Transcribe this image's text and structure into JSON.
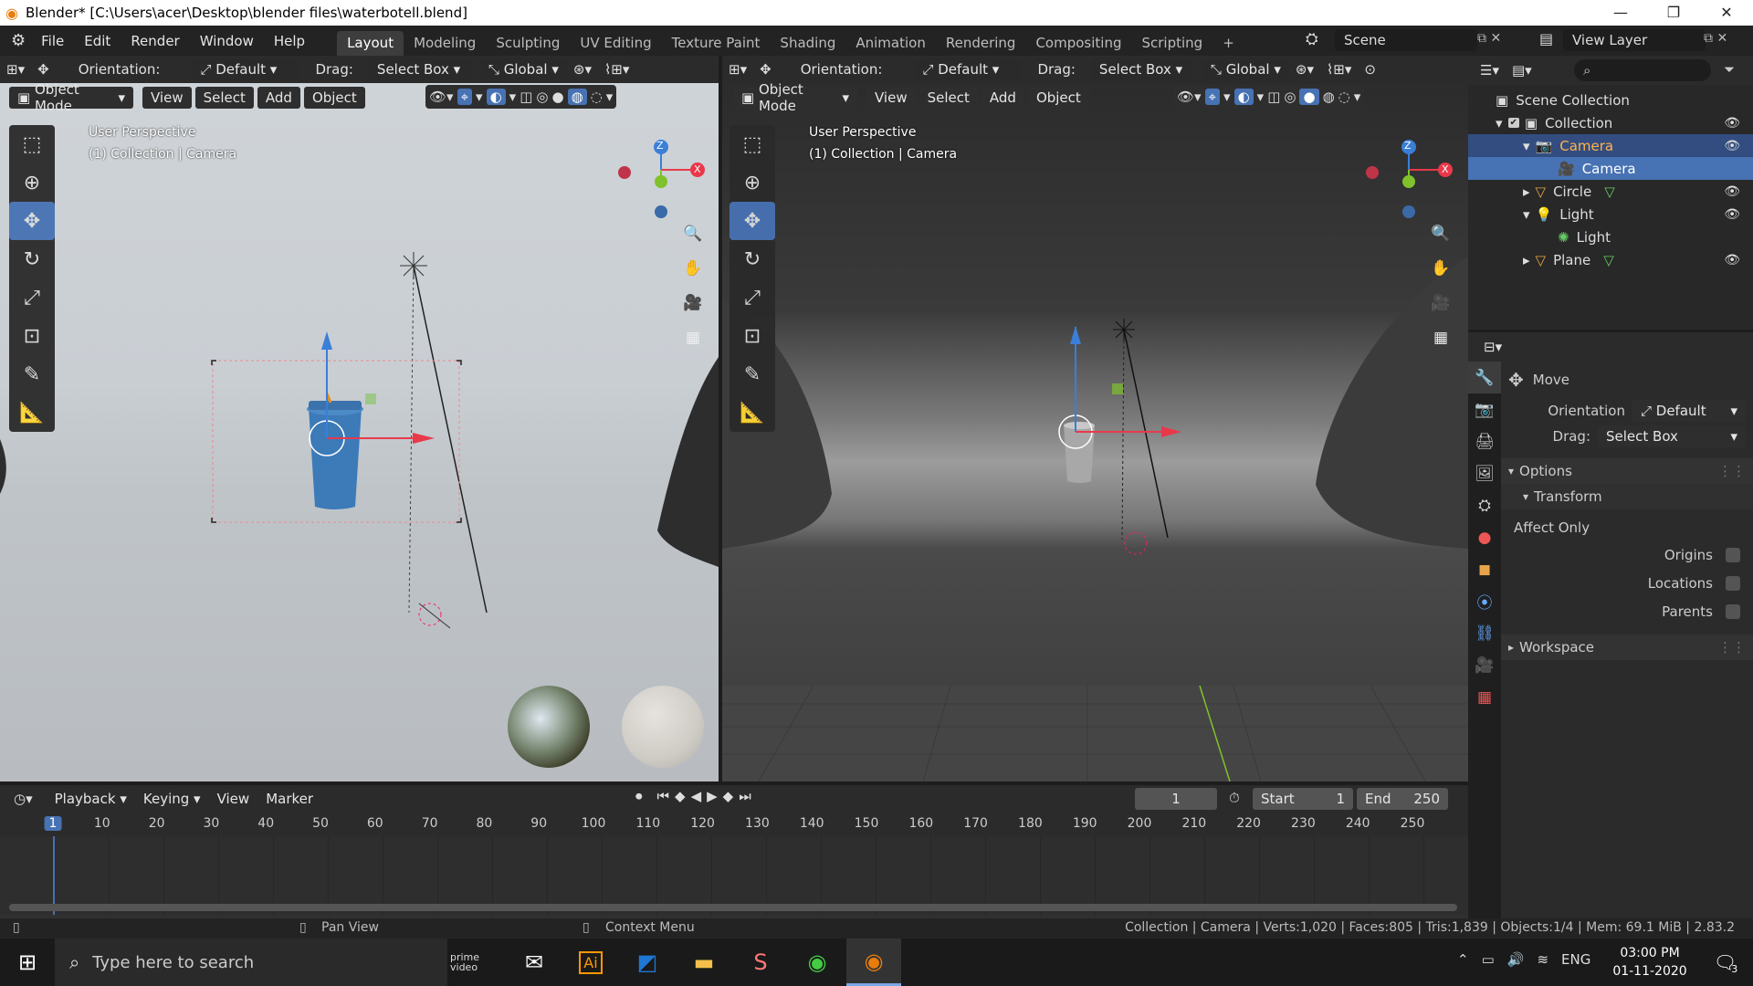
{
  "title": "Blender* [C:\\Users\\acer\\Desktop\\blender files\\waterbotell.blend]",
  "menu": [
    "File",
    "Edit",
    "Render",
    "Window",
    "Help"
  ],
  "workspaces": [
    "Layout",
    "Modeling",
    "Sculpting",
    "UV Editing",
    "Texture Paint",
    "Shading",
    "Animation",
    "Rendering",
    "Compositing",
    "Scripting"
  ],
  "active_workspace": "Layout",
  "scene_name": "Scene",
  "view_layer": "View Layer",
  "viewport_left": {
    "orientation_label": "Orientation:",
    "orientation_value": "Default",
    "drag_label": "Drag:",
    "drag_value": "Select Box",
    "transform_space": "Global",
    "mode": "Object Mode",
    "menus": [
      "View",
      "Select",
      "Add",
      "Object"
    ],
    "perspective": "User Perspective",
    "collection_info": "(1) Collection | Camera",
    "gizmo_x": "X",
    "gizmo_z": "Z"
  },
  "viewport_right": {
    "orientation_label": "Orientation:",
    "orientation_value": "Default",
    "drag_label": "Drag:",
    "drag_value": "Select Box",
    "transform_space": "Global",
    "mode": "Object Mode",
    "menus": [
      "View",
      "Select",
      "Add",
      "Object"
    ],
    "perspective": "User Perspective",
    "collection_info": "(1) Collection | Camera",
    "gizmo_x": "X",
    "gizmo_z": "Z"
  },
  "outliner": {
    "root": "Scene Collection",
    "collection": "Collection",
    "items": [
      {
        "label": "Camera",
        "icon": "camera-object-icon",
        "level": 2,
        "selected": "light"
      },
      {
        "label": "Camera",
        "icon": "camera-data-icon",
        "level": 3,
        "selected": "strong"
      },
      {
        "label": "Circle",
        "icon": "mesh-object-icon",
        "level": 2,
        "selected": "none"
      },
      {
        "label": "Light",
        "icon": "light-object-icon",
        "level": 2,
        "selected": "none"
      },
      {
        "label": "Light",
        "icon": "light-data-icon",
        "level": 3,
        "selected": "none"
      },
      {
        "label": "Plane",
        "icon": "mesh-object-icon",
        "level": 2,
        "selected": "none"
      }
    ]
  },
  "properties": {
    "tool_name": "Move",
    "orientation_label": "Orientation",
    "orientation_value": "Default",
    "drag_label": "Drag:",
    "drag_value": "Select Box",
    "options_header": "Options",
    "transform_header": "Transform",
    "affect_only": "Affect Only",
    "checkboxes": [
      "Origins",
      "Locations",
      "Parents"
    ],
    "workspace_header": "Workspace"
  },
  "timeline": {
    "menus": [
      "Playback",
      "Keying",
      "View",
      "Marker"
    ],
    "current_frame": "1",
    "start_label": "Start",
    "start_value": "1",
    "end_label": "End",
    "end_value": "250",
    "ticks": [
      "1",
      "10",
      "20",
      "30",
      "40",
      "50",
      "60",
      "70",
      "80",
      "90",
      "100",
      "110",
      "120",
      "130",
      "140",
      "150",
      "160",
      "170",
      "180",
      "190",
      "200",
      "210",
      "220",
      "230",
      "240",
      "250"
    ]
  },
  "status": {
    "pan": "Pan View",
    "context": "Context Menu",
    "stats": "Collection | Camera | Verts:1,020 | Faces:805 | Tris:1,839 | Objects:1/4 | Mem: 69.1 MiB | 2.83.2"
  },
  "taskbar": {
    "search_placeholder": "Type here to search",
    "lang": "ENG",
    "time": "03:00 PM",
    "date": "01-11-2020",
    "notif_count": "3",
    "prime": "prime video",
    "ai": "Ai"
  },
  "colors": {
    "accent": "#4772b3",
    "selected_light": "#334d80",
    "x_axis": "#e8394b",
    "y_axis": "#7fc22b",
    "z_axis": "#3a7fd8"
  }
}
